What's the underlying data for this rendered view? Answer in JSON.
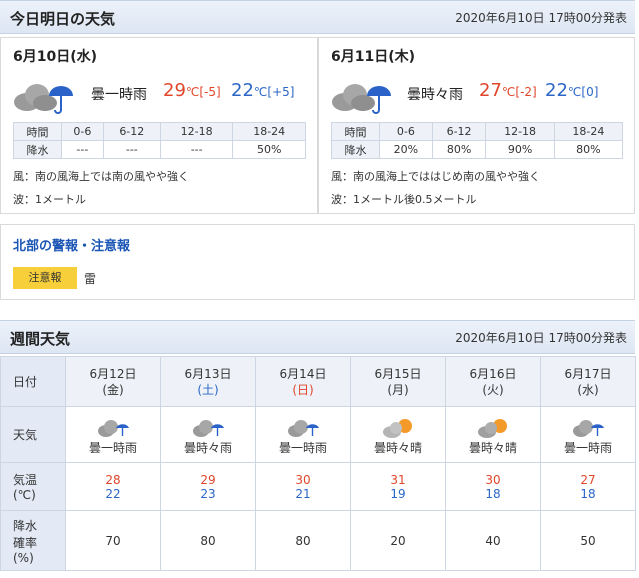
{
  "today_section": {
    "title": "今日明日の天気",
    "issued": "2020年6月10日 17時00分発表",
    "days": [
      {
        "date": "6月10日(水)",
        "icon": "cloud-rain-icon",
        "weather": "曇一時雨",
        "hi": "29",
        "hi_unit": "℃",
        "hi_diff": "[-5]",
        "lo": "22",
        "lo_unit": "℃",
        "lo_diff": "[+5]",
        "rain_header": [
          "時間",
          "0-6",
          "6-12",
          "12-18",
          "18-24"
        ],
        "rain_values": [
          "降水",
          "---",
          "---",
          "---",
          "50%"
        ],
        "wind": "風：南の風海上では南の風やや強く",
        "wave": "波：1メートル"
      },
      {
        "date": "6月11日(木)",
        "icon": "cloud-rain-icon",
        "weather": "曇時々雨",
        "hi": "27",
        "hi_unit": "℃",
        "hi_diff": "[-2]",
        "lo": "22",
        "lo_unit": "℃",
        "lo_diff": "[0]",
        "rain_header": [
          "時間",
          "0-6",
          "6-12",
          "12-18",
          "18-24"
        ],
        "rain_values": [
          "降水",
          "20%",
          "80%",
          "90%",
          "80%"
        ],
        "wind": "風：南の風海上でははじめ南の風やや強く",
        "wave": "波：1メートル後0.5メートル"
      }
    ]
  },
  "alert": {
    "title": "北部の警報・注意報",
    "badge": "注意報",
    "text": "雷"
  },
  "weekly": {
    "title": "週間天気",
    "issued": "2020年6月10日 17時00分発表",
    "row_labels": {
      "date": "日付",
      "weather": "天気",
      "temp_line1": "気温",
      "temp_line2": "(℃)",
      "rain_line1": "降水",
      "rain_line2": "確率",
      "rain_line3": "(%)"
    },
    "days": [
      {
        "date": "6月12日",
        "dow": "(金)",
        "dow_type": "weekday",
        "icon": "cloud-rain-icon",
        "weather": "曇一時雨",
        "hi": "28",
        "lo": "22",
        "pop": "70"
      },
      {
        "date": "6月13日",
        "dow": "(土)",
        "dow_type": "sat",
        "icon": "cloud-rain-icon",
        "weather": "曇時々雨",
        "hi": "29",
        "lo": "23",
        "pop": "80"
      },
      {
        "date": "6月14日",
        "dow": "(日)",
        "dow_type": "sun",
        "icon": "cloud-rain-icon",
        "weather": "曇一時雨",
        "hi": "30",
        "lo": "21",
        "pop": "80"
      },
      {
        "date": "6月15日",
        "dow": "(月)",
        "dow_type": "weekday",
        "icon": "cloud-sun-icon",
        "weather": "曇時々晴",
        "hi": "31",
        "lo": "19",
        "pop": "20"
      },
      {
        "date": "6月16日",
        "dow": "(火)",
        "dow_type": "weekday",
        "icon": "cloud-sun-icon",
        "weather": "曇時々晴",
        "hi": "30",
        "lo": "18",
        "pop": "40"
      },
      {
        "date": "6月17日",
        "dow": "(水)",
        "dow_type": "weekday",
        "icon": "cloud-rain-icon",
        "weather": "曇一時雨",
        "hi": "27",
        "lo": "18",
        "pop": "50"
      }
    ]
  }
}
